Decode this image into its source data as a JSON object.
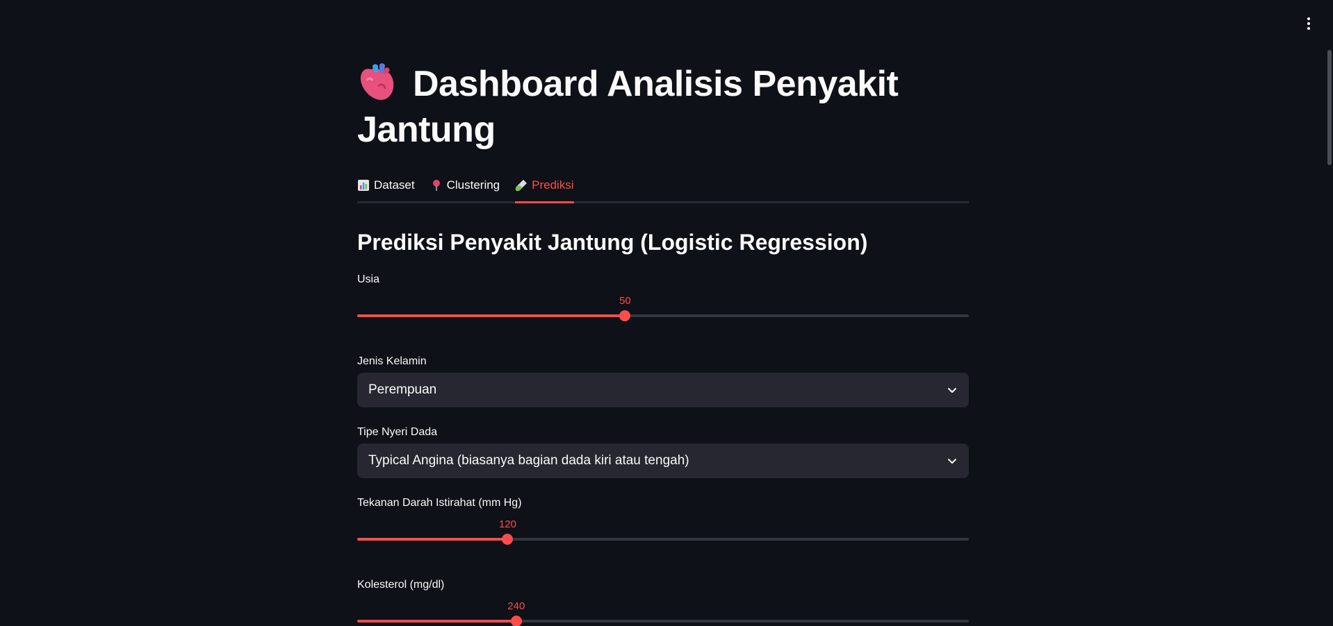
{
  "app": {
    "title": "Dashboard Analisis Penyakit Jantung",
    "accent_color": "#ff4b4b",
    "background_color": "#0e1117"
  },
  "header": {
    "title_icon": "anatomical-heart-icon",
    "menu_icon": "vertical-ellipsis-icon"
  },
  "tabs": [
    {
      "icon": "bar-chart-icon",
      "label": "Dataset",
      "active": false
    },
    {
      "icon": "pushpin-icon",
      "label": "Clustering",
      "active": false
    },
    {
      "icon": "test-tube-icon",
      "label": "Prediksi",
      "active": true
    }
  ],
  "section": {
    "title": "Prediksi Penyakit Jantung (Logistic Regression)"
  },
  "form": {
    "usia": {
      "label": "Usia",
      "value": "50",
      "fraction": 0.438
    },
    "jenis_kelamin": {
      "label": "Jenis Kelamin",
      "selected": "Perempuan"
    },
    "tipe_nyeri_dada": {
      "label": "Tipe Nyeri Dada",
      "selected": "Typical Angina (biasanya bagian dada kiri atau tengah)"
    },
    "tekanan_darah": {
      "label": "Tekanan Darah Istirahat (mm Hg)",
      "value": "120",
      "fraction": 0.246
    },
    "kolesterol": {
      "label": "Kolesterol (mg/dl)",
      "value": "240",
      "fraction": 0.26
    }
  }
}
